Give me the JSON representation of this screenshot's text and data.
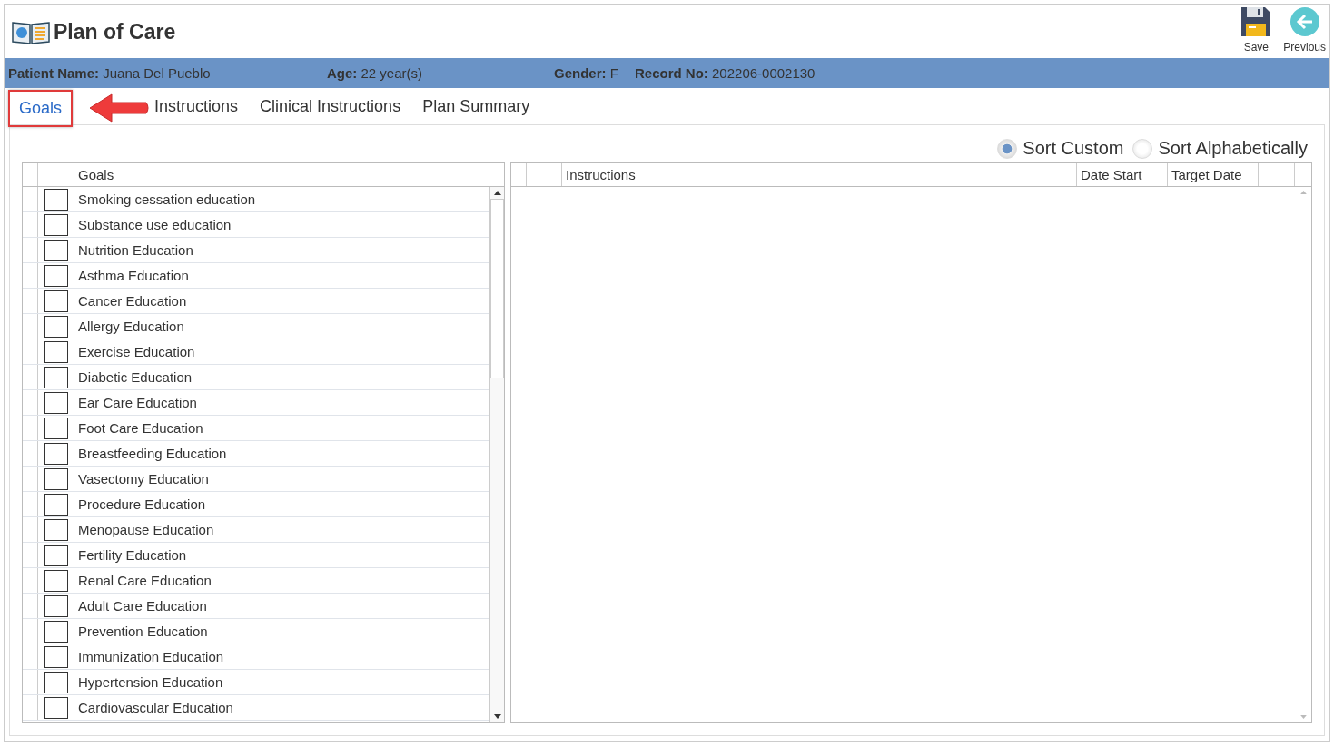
{
  "window": {
    "title": "Plan of Care"
  },
  "toolbar": [
    {
      "kind": "save",
      "label": "Save"
    },
    {
      "kind": "previous",
      "label": "Previous"
    }
  ],
  "patient": [
    {
      "label": "Patient Name:",
      "value": "Juana Del Pueblo"
    },
    {
      "label": "Age:",
      "value": "22 year(s)"
    },
    {
      "label": "Gender:",
      "value": "F"
    },
    {
      "label": "Record No:",
      "value": "202206-0002130"
    }
  ],
  "tabs": [
    {
      "label": "Goals",
      "selected": true
    },
    {
      "label": "Instructions",
      "selected": false
    },
    {
      "label": "Clinical Instructions",
      "selected": false
    },
    {
      "label": "Plan Summary",
      "selected": false
    }
  ],
  "sort": [
    {
      "label": "Sort Custom",
      "selected": true
    },
    {
      "label": "Sort Alphabetically",
      "selected": false
    }
  ],
  "goals_table": {
    "column": "Goals",
    "rows": [
      {
        "label": "Smoking cessation education",
        "checked": false
      },
      {
        "label": "Substance use education",
        "checked": false
      },
      {
        "label": "Nutrition Education",
        "checked": false
      },
      {
        "label": "Asthma Education",
        "checked": false
      },
      {
        "label": "Cancer Education",
        "checked": false
      },
      {
        "label": "Allergy Education",
        "checked": false
      },
      {
        "label": "Exercise Education",
        "checked": false
      },
      {
        "label": "Diabetic Education",
        "checked": false
      },
      {
        "label": "Ear Care Education",
        "checked": false
      },
      {
        "label": "Foot Care Education",
        "checked": false
      },
      {
        "label": "Breastfeeding Education",
        "checked": false
      },
      {
        "label": "Vasectomy Education",
        "checked": false
      },
      {
        "label": "Procedure Education",
        "checked": false
      },
      {
        "label": "Menopause Education",
        "checked": false
      },
      {
        "label": "Fertility Education",
        "checked": false
      },
      {
        "label": "Renal Care Education",
        "checked": false
      },
      {
        "label": "Adult Care Education",
        "checked": false
      },
      {
        "label": "Prevention Education",
        "checked": false
      },
      {
        "label": "Immunization Education",
        "checked": false
      },
      {
        "label": "Hypertension Education",
        "checked": false
      },
      {
        "label": "Cardiovascular Education",
        "checked": false
      }
    ]
  },
  "instructions_table": {
    "columns": [
      "Instructions",
      "Date Start",
      "Target Date"
    ]
  }
}
